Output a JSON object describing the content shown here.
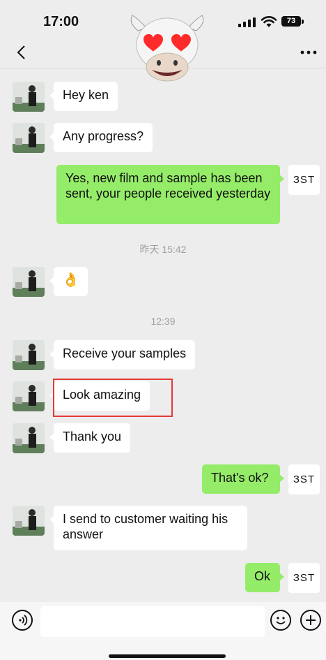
{
  "status": {
    "time": "17:00",
    "battery": "73"
  },
  "nav": {
    "back_icon": "chevron-left-icon",
    "more_icon": "more-dots-icon"
  },
  "messages": [
    {
      "side": "left",
      "text": "Hey ken"
    },
    {
      "side": "left",
      "text": "Any progress?"
    },
    {
      "side": "right",
      "text": "Yes, new film and sample has been sent, your people received yesterday",
      "avatar_label": "ЗST"
    },
    {
      "type": "timestamp",
      "text": "昨天 15:42"
    },
    {
      "side": "left",
      "text": "👌"
    },
    {
      "type": "timestamp",
      "text": "12:39"
    },
    {
      "side": "left",
      "text": "Receive your samples"
    },
    {
      "side": "left",
      "text": "Look amazing",
      "highlighted": true
    },
    {
      "side": "left",
      "text": "Thank you"
    },
    {
      "side": "right",
      "text": "That's ok?",
      "avatar_label": "ЗST"
    },
    {
      "side": "left",
      "text": "I send to customer waiting his answer"
    },
    {
      "side": "right",
      "text": "Ok",
      "avatar_label": "ЗST"
    }
  ],
  "input": {
    "placeholder": ""
  },
  "colors": {
    "background": "#ededed",
    "outgoing_bubble": "#95ec69",
    "incoming_bubble": "#ffffff",
    "highlight": "#e53935"
  }
}
